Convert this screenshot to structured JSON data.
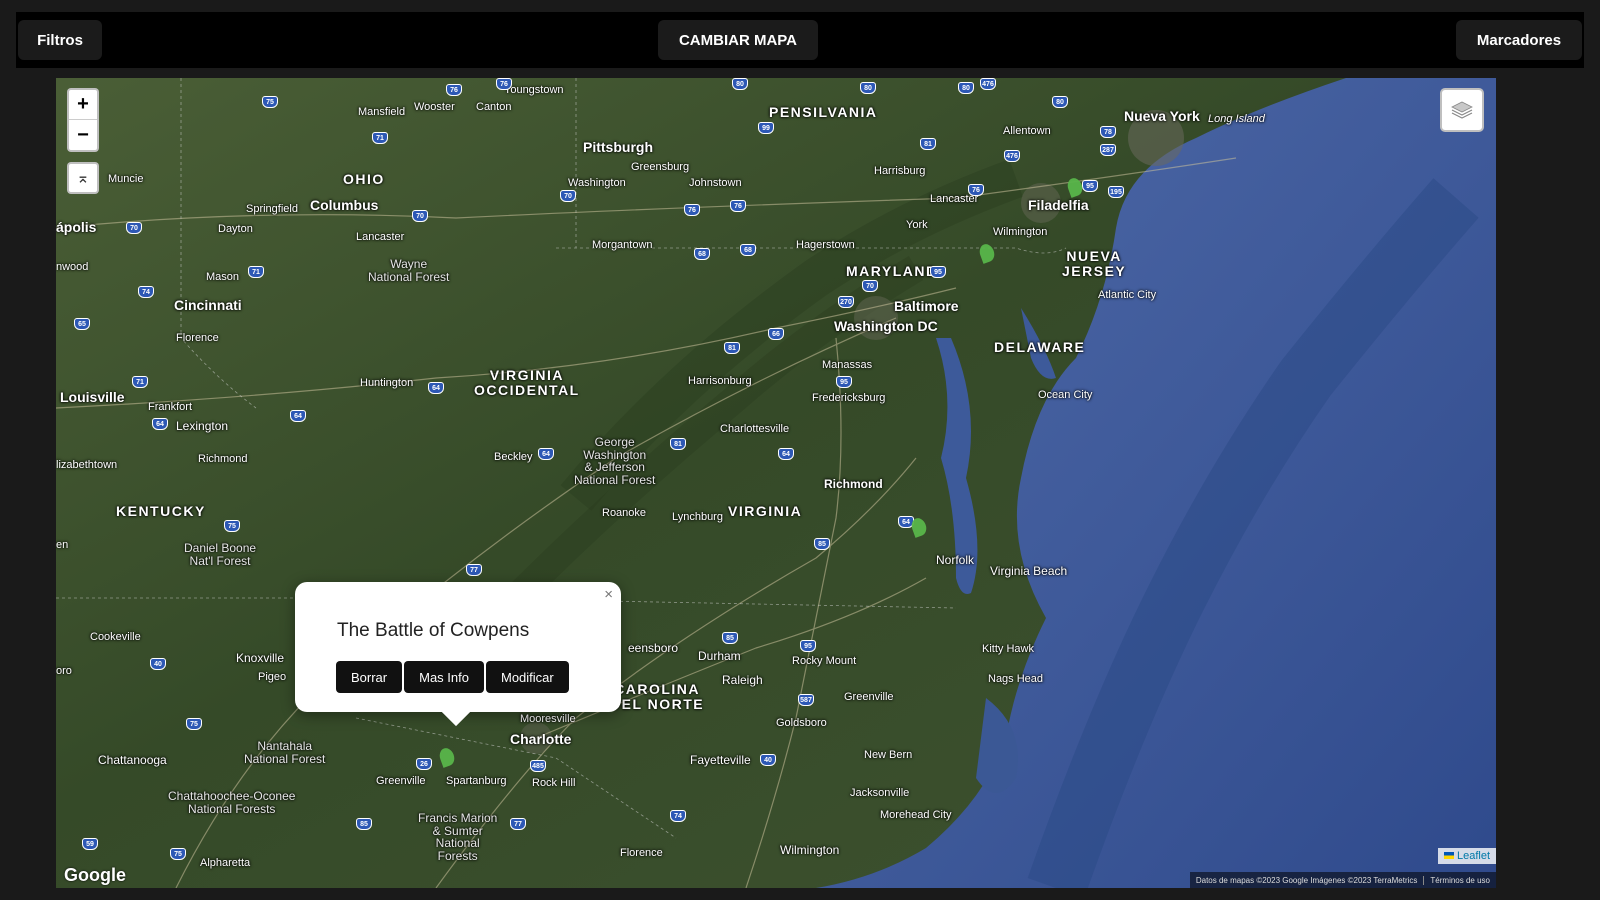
{
  "topbar": {
    "filters_label": "Filtros",
    "change_map_label": "CAMBIAR MAPA",
    "markers_label": "Marcadores"
  },
  "map": {
    "zoom_in": "+",
    "zoom_out": "−",
    "locate_icon": "⌅",
    "google_logo": "Google",
    "leaflet_label": "Leaflet",
    "attribution": "Datos de mapas ©2023 Google Imágenes ©2023 TerraMetrics",
    "terms": "Términos de uso",
    "places": {
      "youngstown": "Youngstown",
      "mansfield": "Mansfield",
      "wooster": "Wooster",
      "canton": "Canton",
      "muncie": "Muncie",
      "ohio": "OHIO",
      "columbus": "Columbus",
      "springfield": "Springfield",
      "dayton": "Dayton",
      "lancaster_oh": "Lancaster",
      "napolis": "ápolis",
      "nwood": "nwood",
      "cincinnati": "Cincinnati",
      "florence_ky": "Florence",
      "mason": "Mason",
      "wayne": "Wayne\nNational Forest",
      "pittsburgh": "Pittsburgh",
      "greensburg": "Greensburg",
      "washington_pa": "Washington",
      "johnstown": "Johnstown",
      "morgantown": "Morgantown",
      "pensilvania": "PENSILVANIA",
      "harrisburg": "Harrisburg",
      "lancaster_pa": "Lancaster",
      "york": "York",
      "hagerstown": "Hagerstown",
      "allentown": "Allentown",
      "nueva_york": "Nueva York",
      "long_island": "Long Island",
      "filadelfia": "Filadelfia",
      "wilmington_de": "Wilmington",
      "nueva_jersey": "NUEVA\nJERSEY",
      "atlantic_city": "Atlantic City",
      "maryland": "MARYLAND",
      "baltimore": "Baltimore",
      "washington_dc": "Washington DC",
      "delaware": "DELAWARE",
      "ocean_city": "Ocean City",
      "manassas": "Manassas",
      "fredericksburg": "Fredericksburg",
      "harrisonburg": "Harrisonburg",
      "charlottesville": "Charlottesville",
      "richmond_va": "Richmond",
      "virginia": "VIRGINIA",
      "lynchburg": "Lynchburg",
      "roanoke": "Roanoke",
      "beckley": "Beckley",
      "huntington": "Huntington",
      "virginia_occidental": "VIRGINIA\nOCCIDENTAL",
      "george_washington": "George\nWashington\n& Jefferson\nNational Forest",
      "louisville": "Louisville",
      "frankfort": "Frankfort",
      "lexington": "Lexington",
      "richmond_ky": "Richmond",
      "elizabethtown": "lizabethtown",
      "kentucky": "KENTUCKY",
      "daniel_boone": "Daniel Boone\nNat'l Forest",
      "en": "en",
      "norfolk": "Norfolk",
      "virginia_beach": "Virginia Beach",
      "kitty_hawk": "Kitty Hawk",
      "nags_head": "Nags Head",
      "greensboro": "eensboro",
      "durham": "Durham",
      "rocky_mount": "Rocky Mount",
      "raleigh": "Raleigh",
      "carolina_norte": "CAROLINA\nDEL NORTE",
      "greenville_nc": "Greenville",
      "goldsboro": "Goldsboro",
      "new_bern": "New Bern",
      "fayetteville": "Fayetteville",
      "jacksonville": "Jacksonville",
      "morehead": "Morehead City",
      "wilmington_nc": "Wilmington",
      "florence_sc": "Florence",
      "mooresville": "Mooresville",
      "charlotte": "Charlotte",
      "rock_hill": "Rock Hill",
      "spartanburg": "Spartanburg",
      "greenville_sc": "Greenville",
      "francis_marion": "Francis Marion\n& Sumter\nNational\nForests",
      "cookeville": "Cookeville",
      "knoxville": "Knoxville",
      "pigeon": "Pigeo",
      "oro": "oro",
      "chattanooga": "Chattanooga",
      "nantahala": "Nantahala\nNational Forest",
      "chattahoochee": "Chattahoochee-Oconee\nNational Forests",
      "alpharetta": "Alpharetta"
    }
  },
  "popup": {
    "title": "The Battle of Cowpens",
    "close": "×",
    "delete_label": "Borrar",
    "more_info_label": "Mas Info",
    "modify_label": "Modificar"
  },
  "colors": {
    "land": "#3f5530",
    "ocean": "#3c5a9e",
    "marker": "#59b54a"
  }
}
